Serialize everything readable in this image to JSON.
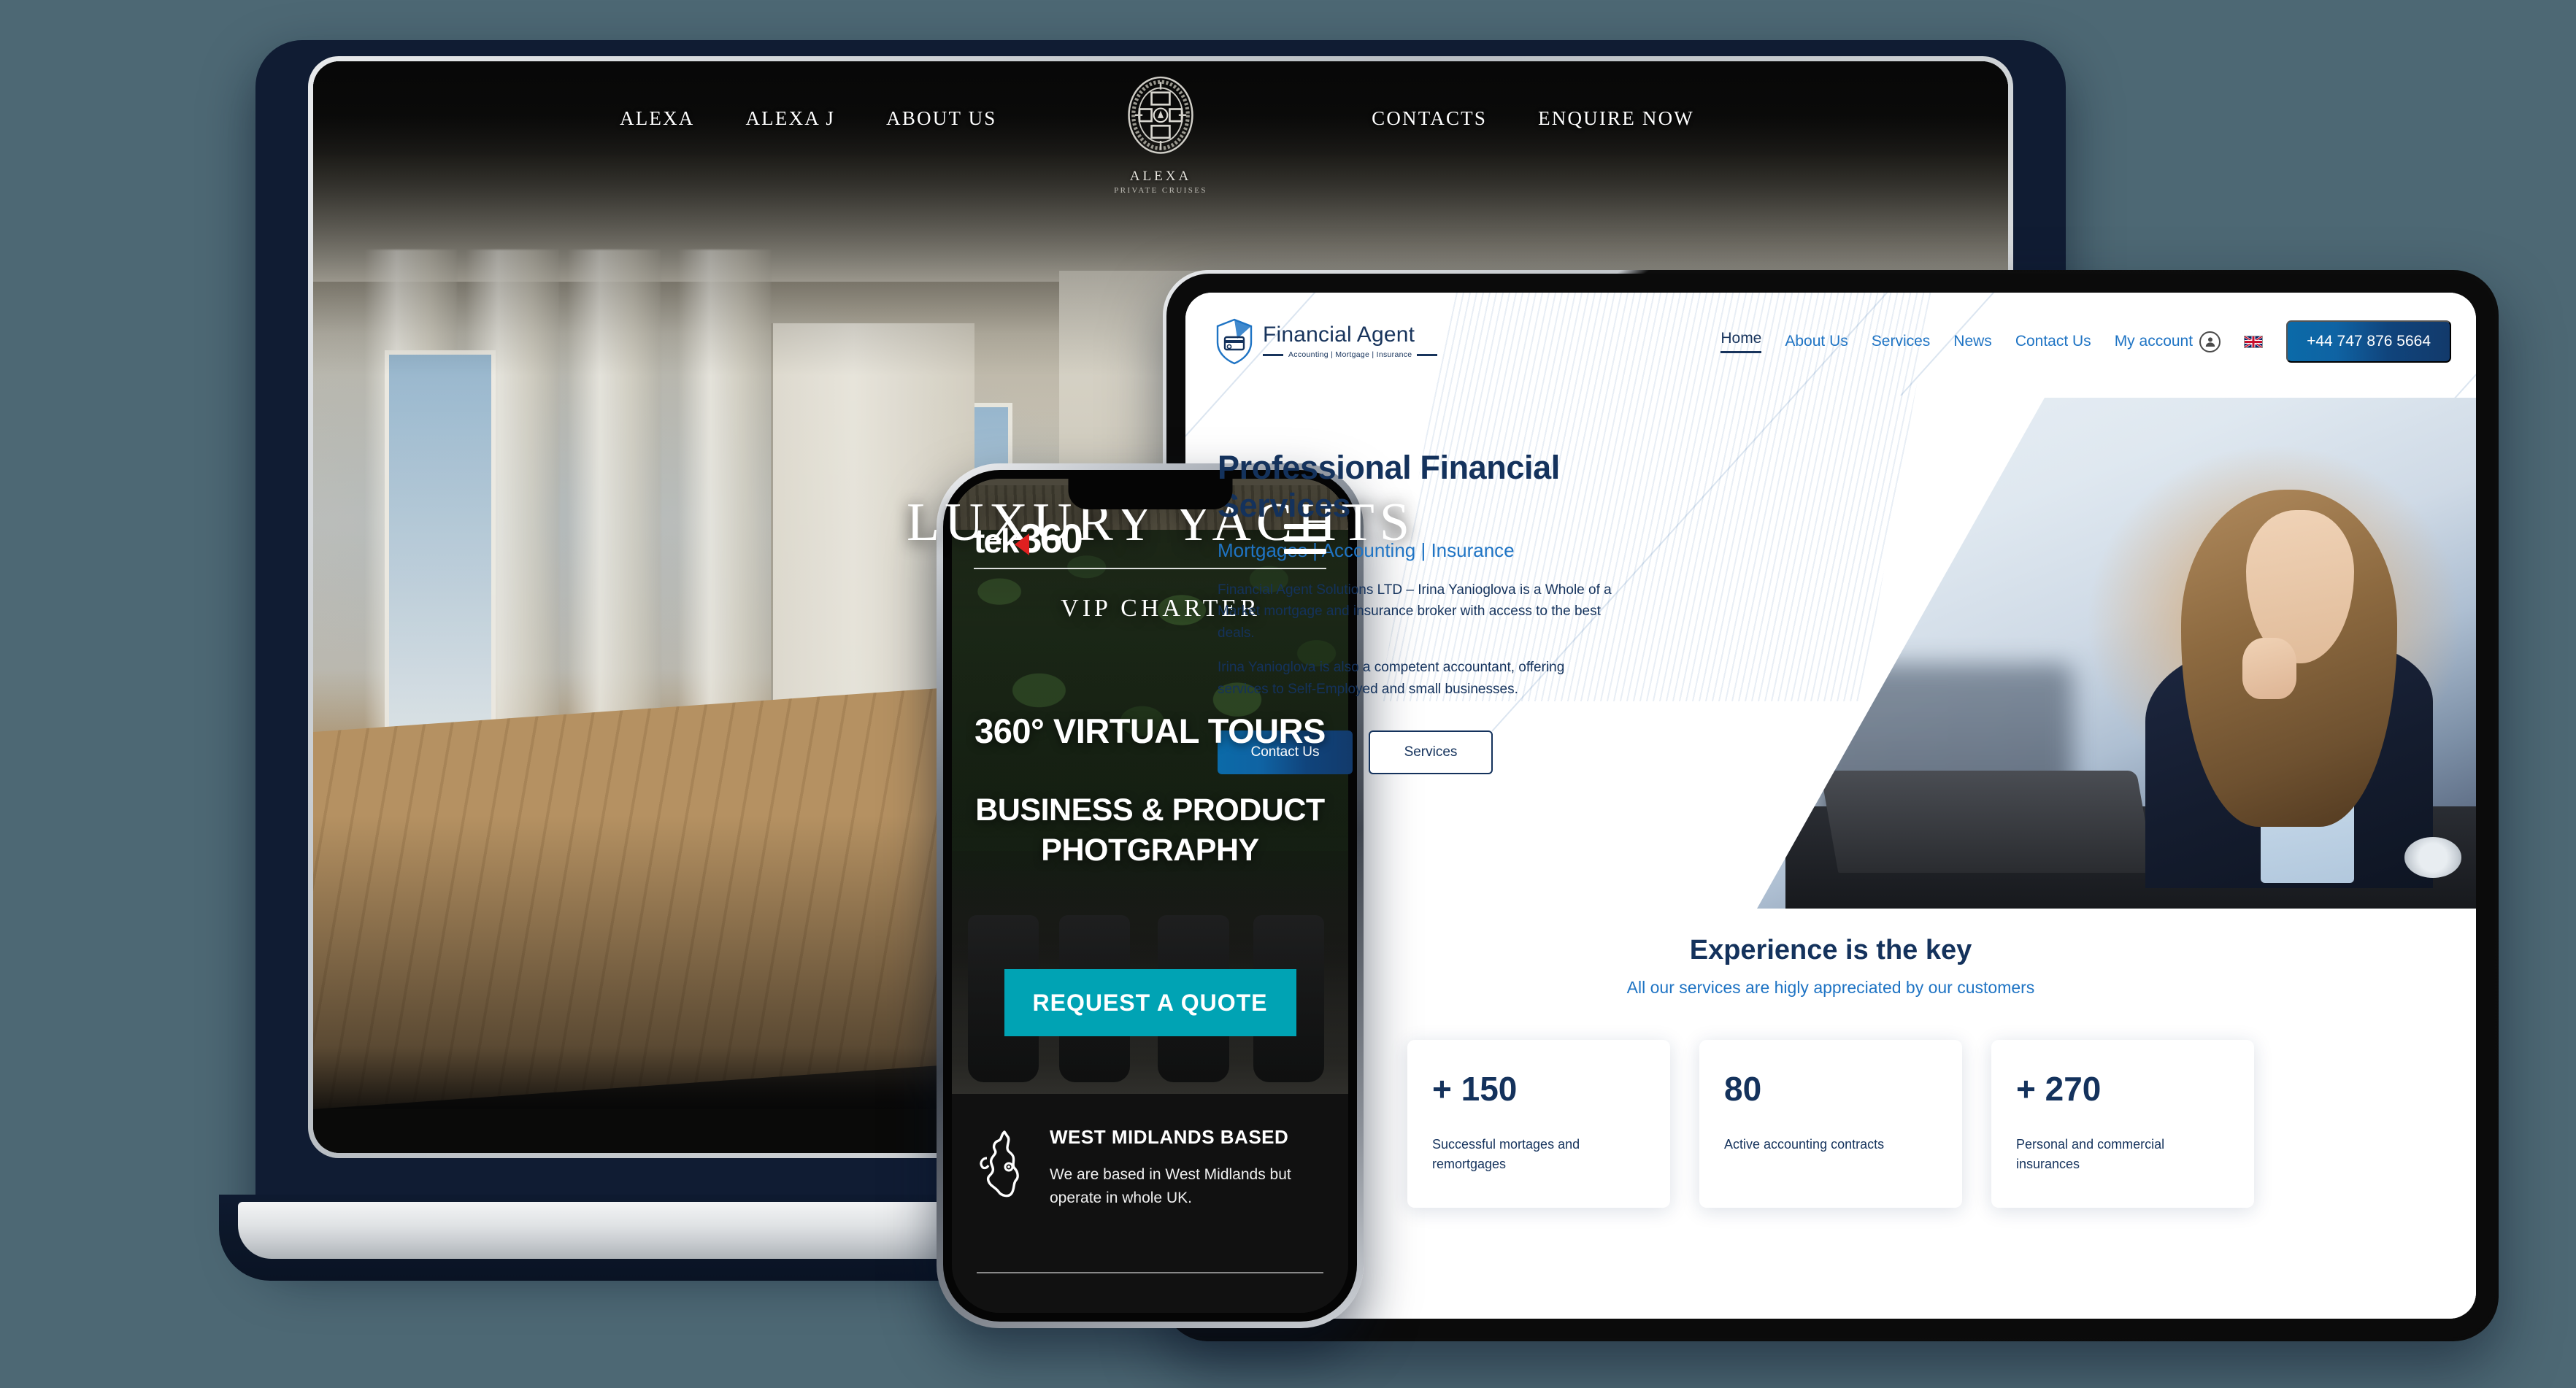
{
  "background_color": "#4d6874",
  "laptop": {
    "device": "laptop",
    "site": {
      "brand": {
        "logo_name": "ALEXA",
        "logo_tagline": "PRIVATE CRUISES",
        "logo_icon": "alexa-crest-emblem"
      },
      "nav_left": [
        {
          "label": "ALEXA"
        },
        {
          "label": "ALEXA J"
        },
        {
          "label": "ABOUT US"
        }
      ],
      "nav_right": [
        {
          "label": "CONTACTS"
        },
        {
          "label": "ENQUIRE NOW"
        }
      ],
      "hero": {
        "title": "LUXURY YACHTS",
        "subtitle": "VIP CHARTER"
      }
    }
  },
  "tablet": {
    "device": "tablet",
    "site": {
      "logo": {
        "name": "Financial Agent",
        "tagline": "Accounting | Mortgage | Insurance",
        "icon": "shield-card-logo-icon"
      },
      "nav": [
        {
          "label": "Home",
          "active": true
        },
        {
          "label": "About Us",
          "active": false
        },
        {
          "label": "Services",
          "active": false
        },
        {
          "label": "News",
          "active": false
        },
        {
          "label": "Contact Us",
          "active": false
        }
      ],
      "account": {
        "label": "My account",
        "icon": "user-circle-icon"
      },
      "language_flag": "uk-flag-icon",
      "phone_button": "+44 747 876 5664",
      "hero": {
        "title": "Professional Financial Services",
        "subtitle": "Mortgages | Accounting | Insurance",
        "paragraph_1": "Financial Agent Solutions LTD – Irina Yanioglova is a Whole of a Market mortgage and insurance broker with access to the best deals.",
        "paragraph_2": "Irina Yanioglova is also a competent accountant, offering services to Self-Employed and small businesses.",
        "primary_button": "Contact Us",
        "secondary_button": "Services",
        "image_alt": "businesswoman-at-desk-photo"
      },
      "experience": {
        "heading": "Experience is the key",
        "subheading": "All our services are higly appreciated by our customers",
        "stats": [
          {
            "value": "+ 150",
            "label": "Successful mortages and remortgages"
          },
          {
            "value": "80",
            "label": "Active accounting contracts"
          },
          {
            "value": "+ 270",
            "label": "Personal and commercial insurances"
          }
        ]
      },
      "colors": {
        "navy": "#14325c",
        "blue": "#1f74c4",
        "button_gradient_start": "#0b6aa8",
        "button_gradient_end": "#123a6b"
      }
    }
  },
  "phone": {
    "device": "smartphone",
    "site": {
      "logo": {
        "text_part_1": "tek",
        "text_part_2": "360",
        "arrow_icon": "red-chevron-icon",
        "arrow_color": "#e02020"
      },
      "menu_icon": "hamburger-menu-icon",
      "hero": {
        "title": "360° VIRTUAL TOURS",
        "subtitle": "BUSINESS & PRODUCT PHOTGRAPHY",
        "cta_label": "REQUEST A QUOTE",
        "cta_color": "#00a3b4"
      },
      "footer": {
        "icon": "uk-map-pin-icon",
        "title": "WEST MIDLANDS BASED",
        "text": "We are based in West Midlands but operate in whole UK."
      }
    }
  }
}
